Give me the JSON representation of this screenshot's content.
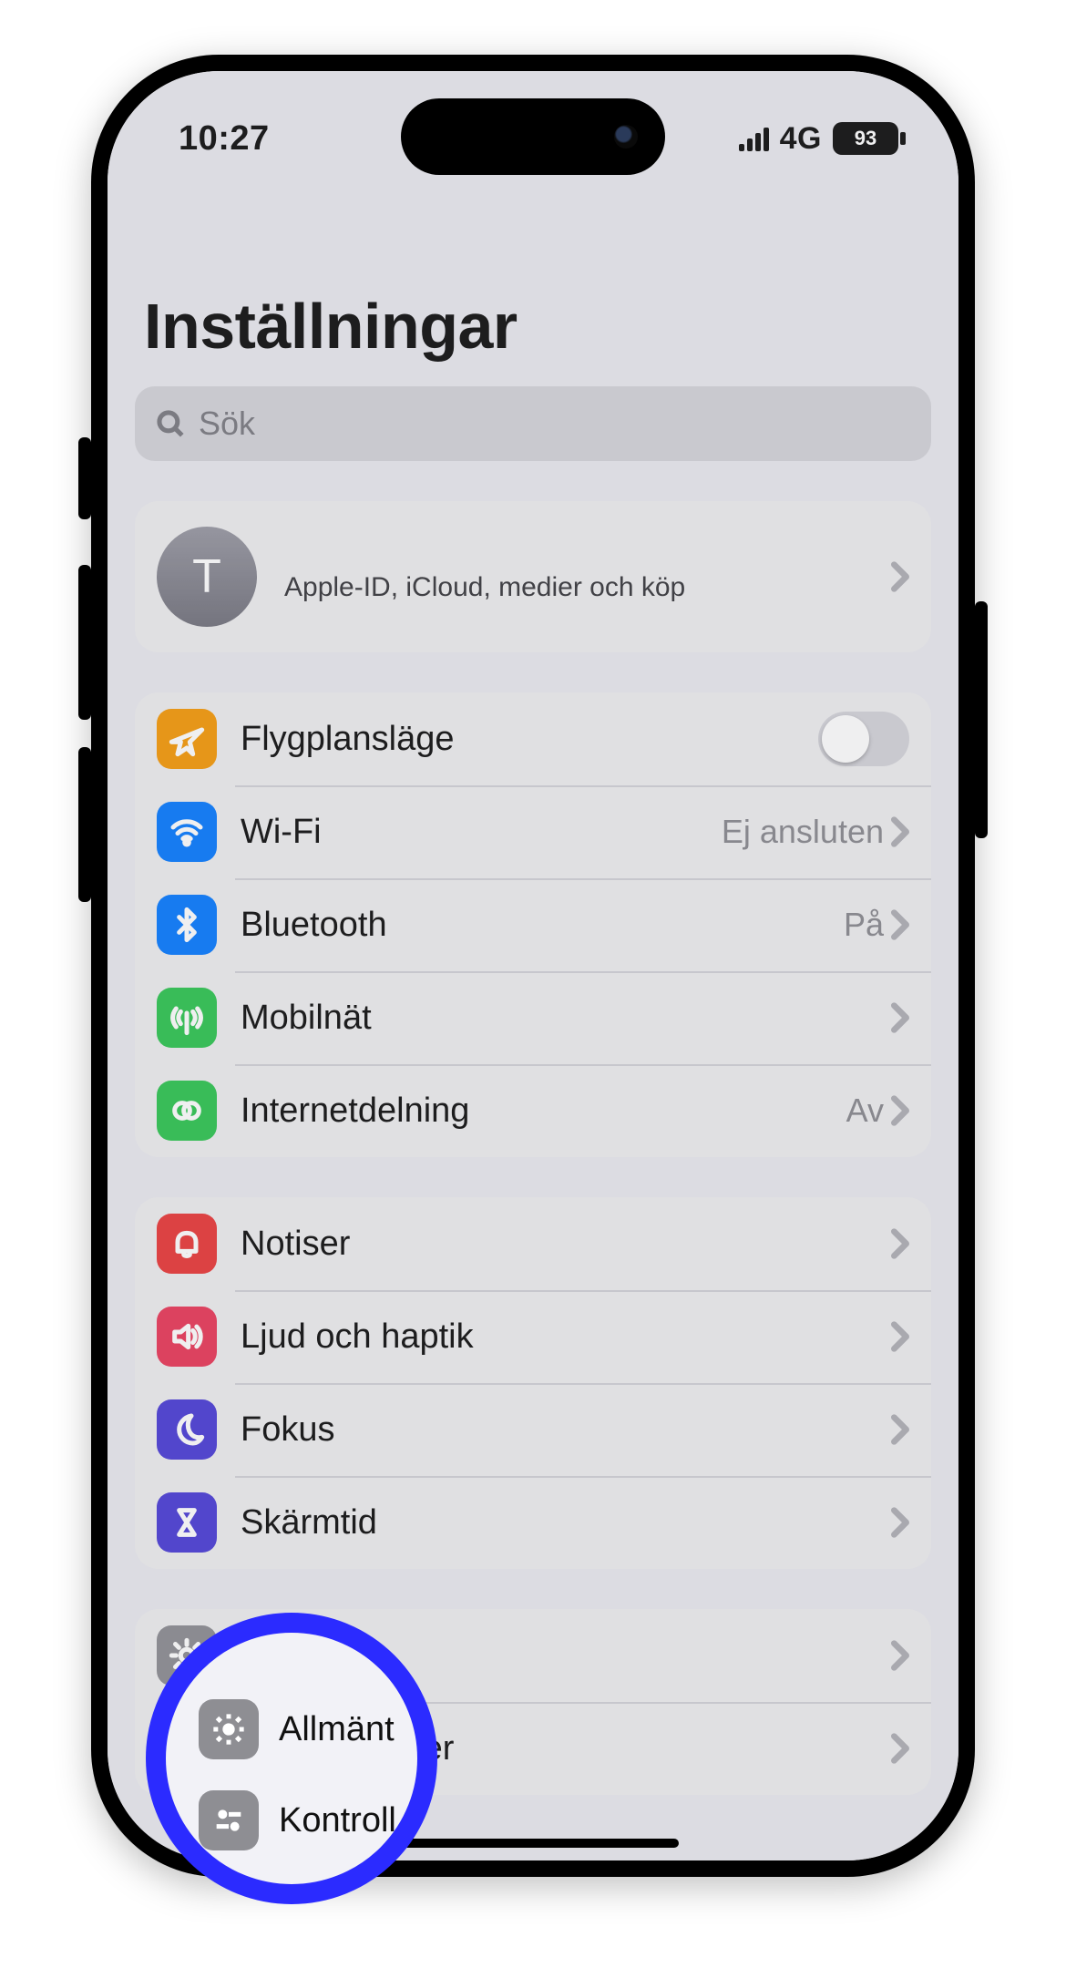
{
  "statusbar": {
    "time": "10:27",
    "network_label": "4G",
    "battery_pct": "93"
  },
  "page": {
    "title": "Inställningar",
    "search_placeholder": "Sök"
  },
  "account": {
    "avatar_initial": "T",
    "subtitle": "Apple-ID, iCloud, medier och köp"
  },
  "groups": [
    {
      "rows": [
        {
          "name": "airplane",
          "label": "Flygplansläge",
          "value": "",
          "has_chevron": false,
          "has_switch": true
        },
        {
          "name": "wifi",
          "label": "Wi-Fi",
          "value": "Ej ansluten",
          "has_chevron": true,
          "has_switch": false
        },
        {
          "name": "bluetooth",
          "label": "Bluetooth",
          "value": "På",
          "has_chevron": true,
          "has_switch": false
        },
        {
          "name": "cellular",
          "label": "Mobilnät",
          "value": "",
          "has_chevron": true,
          "has_switch": false
        },
        {
          "name": "hotspot",
          "label": "Internetdelning",
          "value": "Av",
          "has_chevron": true,
          "has_switch": false
        }
      ]
    },
    {
      "rows": [
        {
          "name": "notifications",
          "label": "Notiser",
          "value": "",
          "has_chevron": true,
          "has_switch": false
        },
        {
          "name": "sounds",
          "label": "Ljud och haptik",
          "value": "",
          "has_chevron": true,
          "has_switch": false
        },
        {
          "name": "focus",
          "label": "Fokus",
          "value": "",
          "has_chevron": true,
          "has_switch": false
        },
        {
          "name": "screentime",
          "label": "Skärmtid",
          "value": "",
          "has_chevron": true,
          "has_switch": false
        }
      ]
    },
    {
      "rows": [
        {
          "name": "general",
          "label": "Allmänt",
          "value": "",
          "has_chevron": true,
          "has_switch": false
        },
        {
          "name": "controlcenter",
          "label": "Kontrollcenter",
          "value": "",
          "has_chevron": true,
          "has_switch": false
        }
      ]
    }
  ],
  "highlight": {
    "row1_label": "Allmänt",
    "row2_label": "Kontroll"
  }
}
